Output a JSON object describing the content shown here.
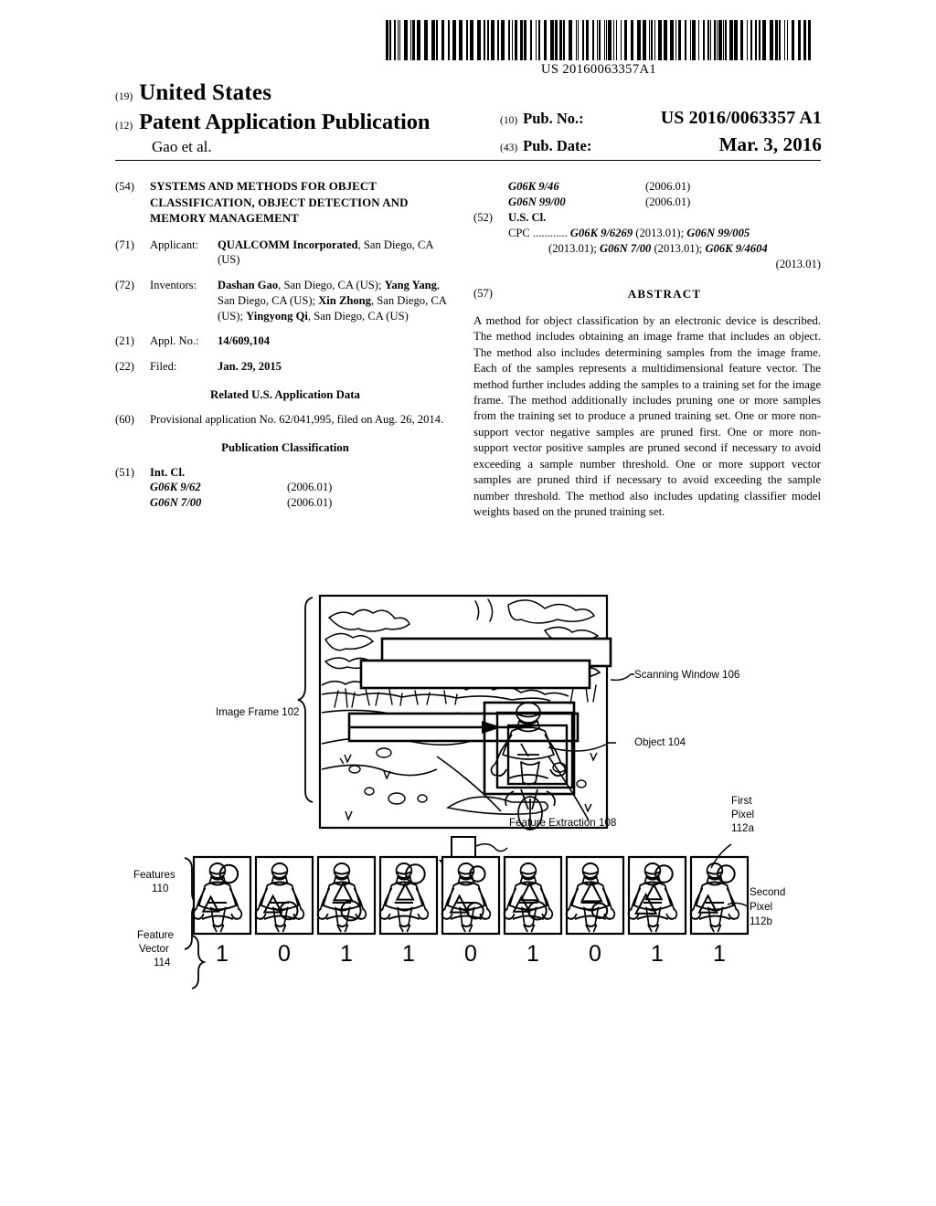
{
  "barcode": {
    "number": "US 20160063357A1"
  },
  "masthead": {
    "code_19": "(19)",
    "country": "United States",
    "code_12": "(12)",
    "doc_type": "Patent Application Publication",
    "authors": "Gao et al.",
    "code_10": "(10)",
    "pub_no_label": "Pub. No.:",
    "pub_no_value": "US 2016/0063357 A1",
    "code_43": "(43)",
    "pub_date_label": "Pub. Date:",
    "pub_date_value": "Mar. 3, 2016"
  },
  "left_column": {
    "title_code": "(54)",
    "title": "SYSTEMS AND METHODS FOR OBJECT CLASSIFICATION, OBJECT DETECTION AND MEMORY MANAGEMENT",
    "applicant_code": "(71)",
    "applicant_label": "Applicant:",
    "applicant_name": "QUALCOMM Incorporated",
    "applicant_rest": ", San Diego, CA (US)",
    "inventors_code": "(72)",
    "inventors_label": "Inventors:",
    "inventors": [
      {
        "name": "Dashan Gao",
        "rest": ", San Diego, CA (US);"
      },
      {
        "name": "Yang Yang",
        "rest": ", San Diego, CA (US);"
      },
      {
        "name": "Xin Zhong",
        "rest": ", San Diego, CA (US);"
      },
      {
        "name": "Yingyong Qi",
        "rest": ", San Diego, CA (US)"
      }
    ],
    "appl_no_code": "(21)",
    "appl_no_label": "Appl. No.:",
    "appl_no_value": "14/609,104",
    "filed_code": "(22)",
    "filed_label": "Filed:",
    "filed_value": "Jan. 29, 2015",
    "related_heading": "Related U.S. Application Data",
    "related_code": "(60)",
    "related_text": "Provisional application No. 62/041,995, filed on Aug. 26, 2014.",
    "pubclass_heading": "Publication Classification",
    "intcl_code": "(51)",
    "intcl_label": "Int. Cl.",
    "intcl_rows": [
      {
        "code": "G06K 9/62",
        "version": "(2006.01)"
      },
      {
        "code": "G06N 7/00",
        "version": "(2006.01)"
      }
    ]
  },
  "right_column": {
    "intcl_rows": [
      {
        "code": "G06K 9/46",
        "version": "(2006.01)"
      },
      {
        "code": "G06N 99/00",
        "version": "(2006.01)"
      }
    ],
    "uscl_code": "(52)",
    "uscl_label": "U.S. Cl.",
    "cpc_prefix": "CPC ............",
    "cpc_1": "G06K 9/6269",
    "cpc_1_v": "(2013.01);",
    "cpc_2": "G06N 99/005",
    "cpc_2_v": "(2013.01);",
    "cpc_3": "G06N 7/00",
    "cpc_3_v": "(2013.01);",
    "cpc_4": "G06K 9/4604",
    "cpc_4_v": "(2013.01)",
    "abstract_code": "(57)",
    "abstract_heading": "ABSTRACT",
    "abstract_text": "A method for object classification by an electronic device is described. The method includes obtaining an image frame that includes an object. The method also includes determining samples from the image frame. Each of the samples represents a multidimensional feature vector. The method further includes adding the samples to a training set for the image frame. The method additionally includes pruning one or more samples from the training set to produce a pruned training set. One or more non-support vector negative samples are pruned first. One or more non-support vector positive samples are pruned second if necessary to avoid exceeding a sample number threshold. One or more support vector samples are pruned third if necessary to avoid exceeding the sample number threshold. The method also includes updating classifier model weights based on the pruned training set."
  },
  "figure": {
    "image_frame_label": "Image Frame 102",
    "scanning_window_label": "Scanning Window 106",
    "object_label": "Object 104",
    "feature_extraction_label": "Feature Extraction 108",
    "features_label_line1": "Features",
    "features_label_line2": "110",
    "feature_vector_label_line1": "Feature",
    "feature_vector_label_line2": "Vector",
    "feature_vector_label_line3": "114",
    "first_pixel_line1": "First",
    "first_pixel_line2": "Pixel",
    "first_pixel_line3": "112a",
    "second_pixel_line1": "Second",
    "second_pixel_line2": "Pixel",
    "second_pixel_line3": "112b",
    "feature_vector_bits": [
      "1",
      "0",
      "1",
      "1",
      "0",
      "1",
      "0",
      "1",
      "1"
    ]
  }
}
